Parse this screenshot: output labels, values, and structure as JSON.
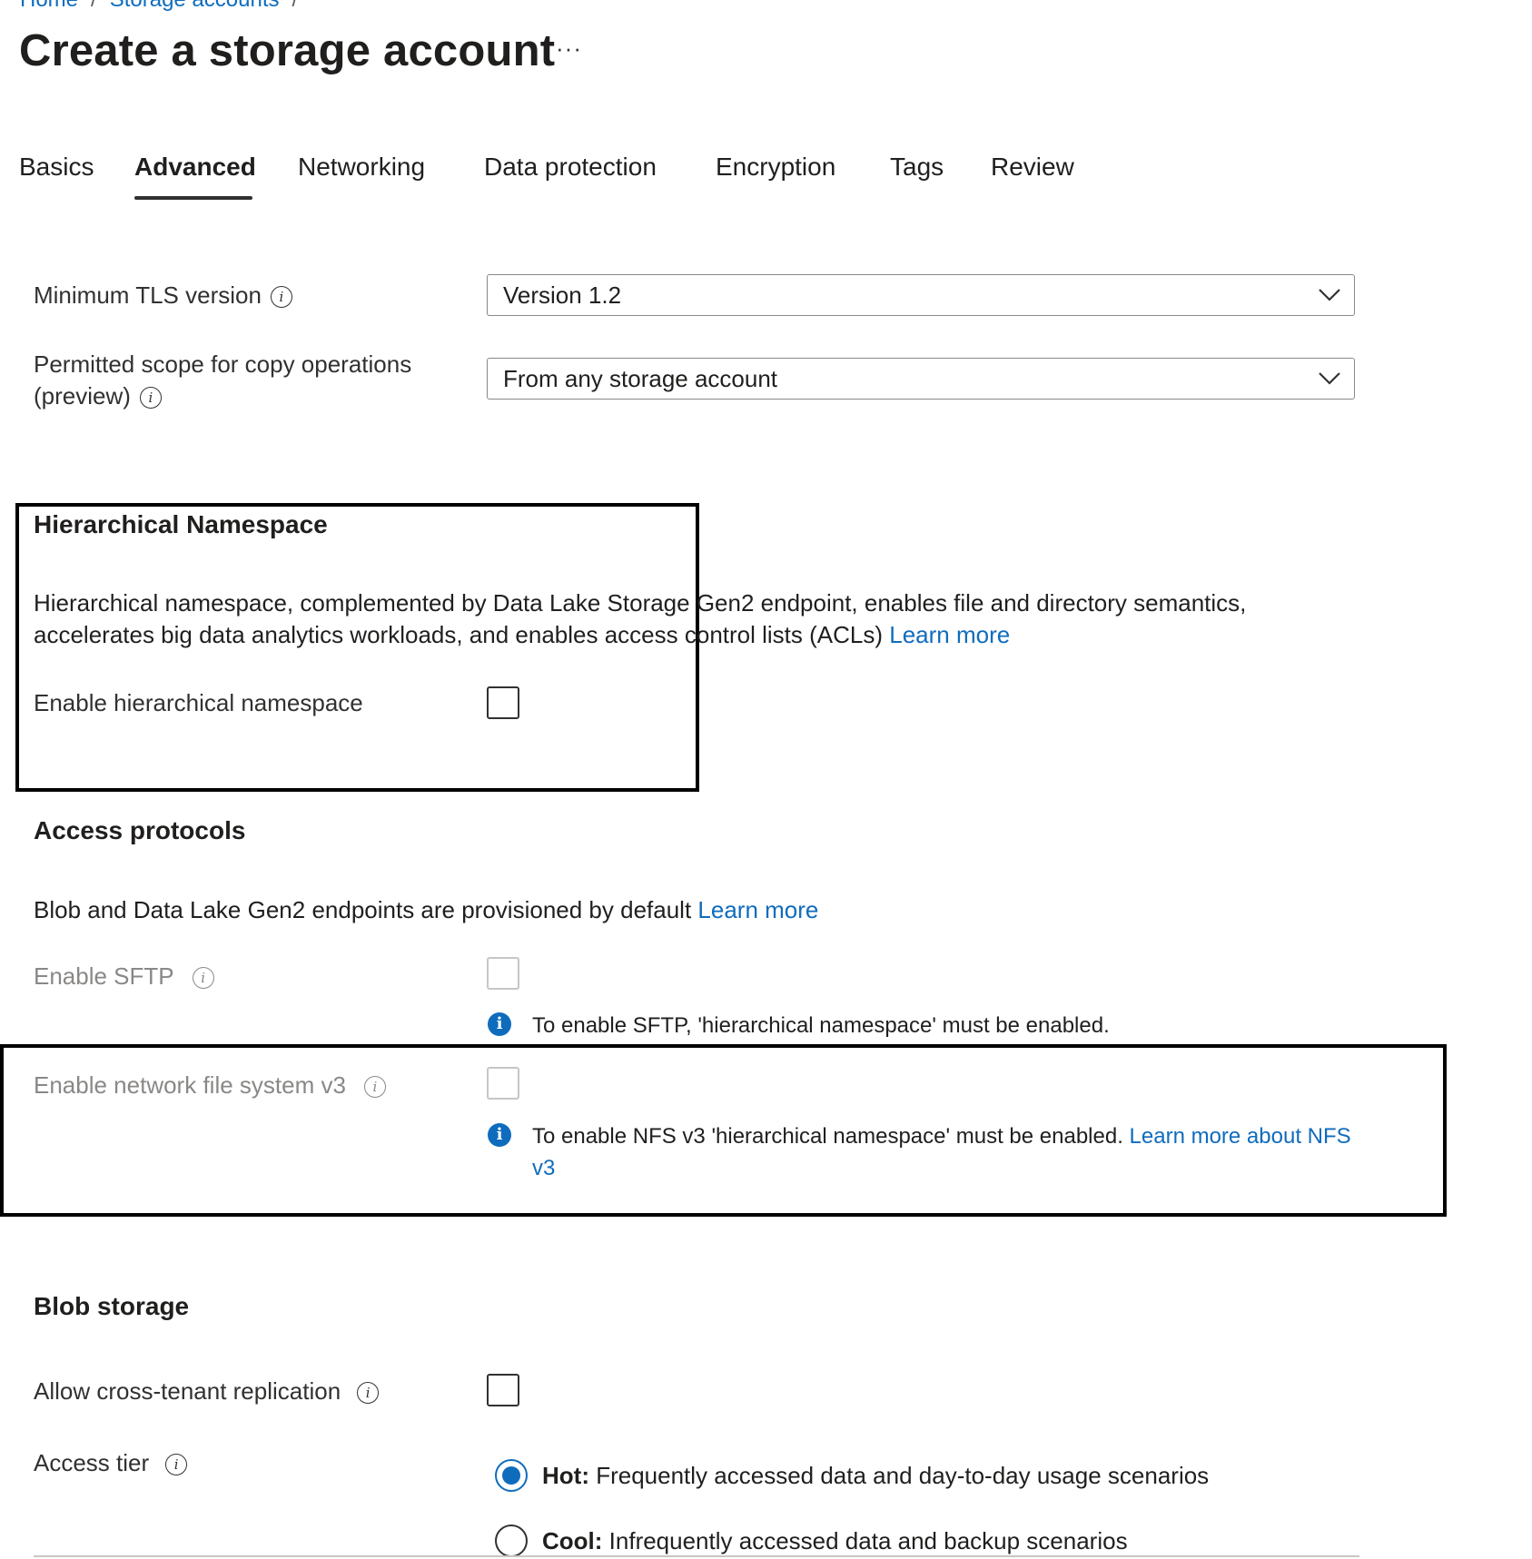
{
  "breadcrumb": {
    "home": "Home",
    "storage_accounts": "Storage accounts",
    "separator": "/"
  },
  "page": {
    "title": "Create a storage account",
    "more_label": "···"
  },
  "tabs": [
    {
      "label": "Basics"
    },
    {
      "label": "Advanced"
    },
    {
      "label": "Networking"
    },
    {
      "label": "Data protection"
    },
    {
      "label": "Encryption"
    },
    {
      "label": "Tags"
    },
    {
      "label": "Review"
    }
  ],
  "active_tab": "Advanced",
  "fields": {
    "min_tls": {
      "label": "Minimum TLS version",
      "value": "Version 1.2"
    },
    "copy_scope": {
      "label_line1": "Permitted scope for copy operations",
      "label_line2": "(preview)",
      "value": "From any storage account"
    }
  },
  "hierarchical_namespace": {
    "heading": "Hierarchical Namespace",
    "description": "Hierarchical namespace, complemented by Data Lake Storage Gen2 endpoint, enables file and directory semantics, accelerates big data analytics workloads, and enables access control lists (ACLs)",
    "learn_more": "Learn more",
    "enable_label": "Enable hierarchical namespace",
    "enabled": false
  },
  "access_protocols": {
    "heading": "Access protocols",
    "description": "Blob and Data Lake Gen2 endpoints are provisioned by default",
    "learn_more": "Learn more",
    "sftp": {
      "label": "Enable SFTP",
      "note": "To enable SFTP, 'hierarchical namespace' must be enabled.",
      "enabled": false,
      "disabled": true
    },
    "nfs": {
      "label": "Enable network file system v3",
      "note": "To enable NFS v3 'hierarchical namespace' must be enabled.",
      "note_link": "Learn more about NFS v3",
      "enabled": false,
      "disabled": true
    }
  },
  "blob_storage": {
    "heading": "Blob storage",
    "cross_tenant": {
      "label": "Allow cross-tenant replication",
      "enabled": false
    },
    "access_tier": {
      "label": "Access tier",
      "options": [
        {
          "name": "Hot:",
          "desc": "Frequently accessed data and day-to-day usage scenarios",
          "selected": true
        },
        {
          "name": "Cool:",
          "desc": "Infrequently accessed data and backup scenarios",
          "selected": false
        }
      ]
    }
  },
  "colors": {
    "link": "#0f6cbd",
    "text": "#201f1e",
    "disabled_text": "#8a8886",
    "highlight_border": "#000000"
  },
  "icons": {
    "info": "info-icon",
    "chevron": "chevron-down-icon",
    "note": "info-filled-icon"
  }
}
